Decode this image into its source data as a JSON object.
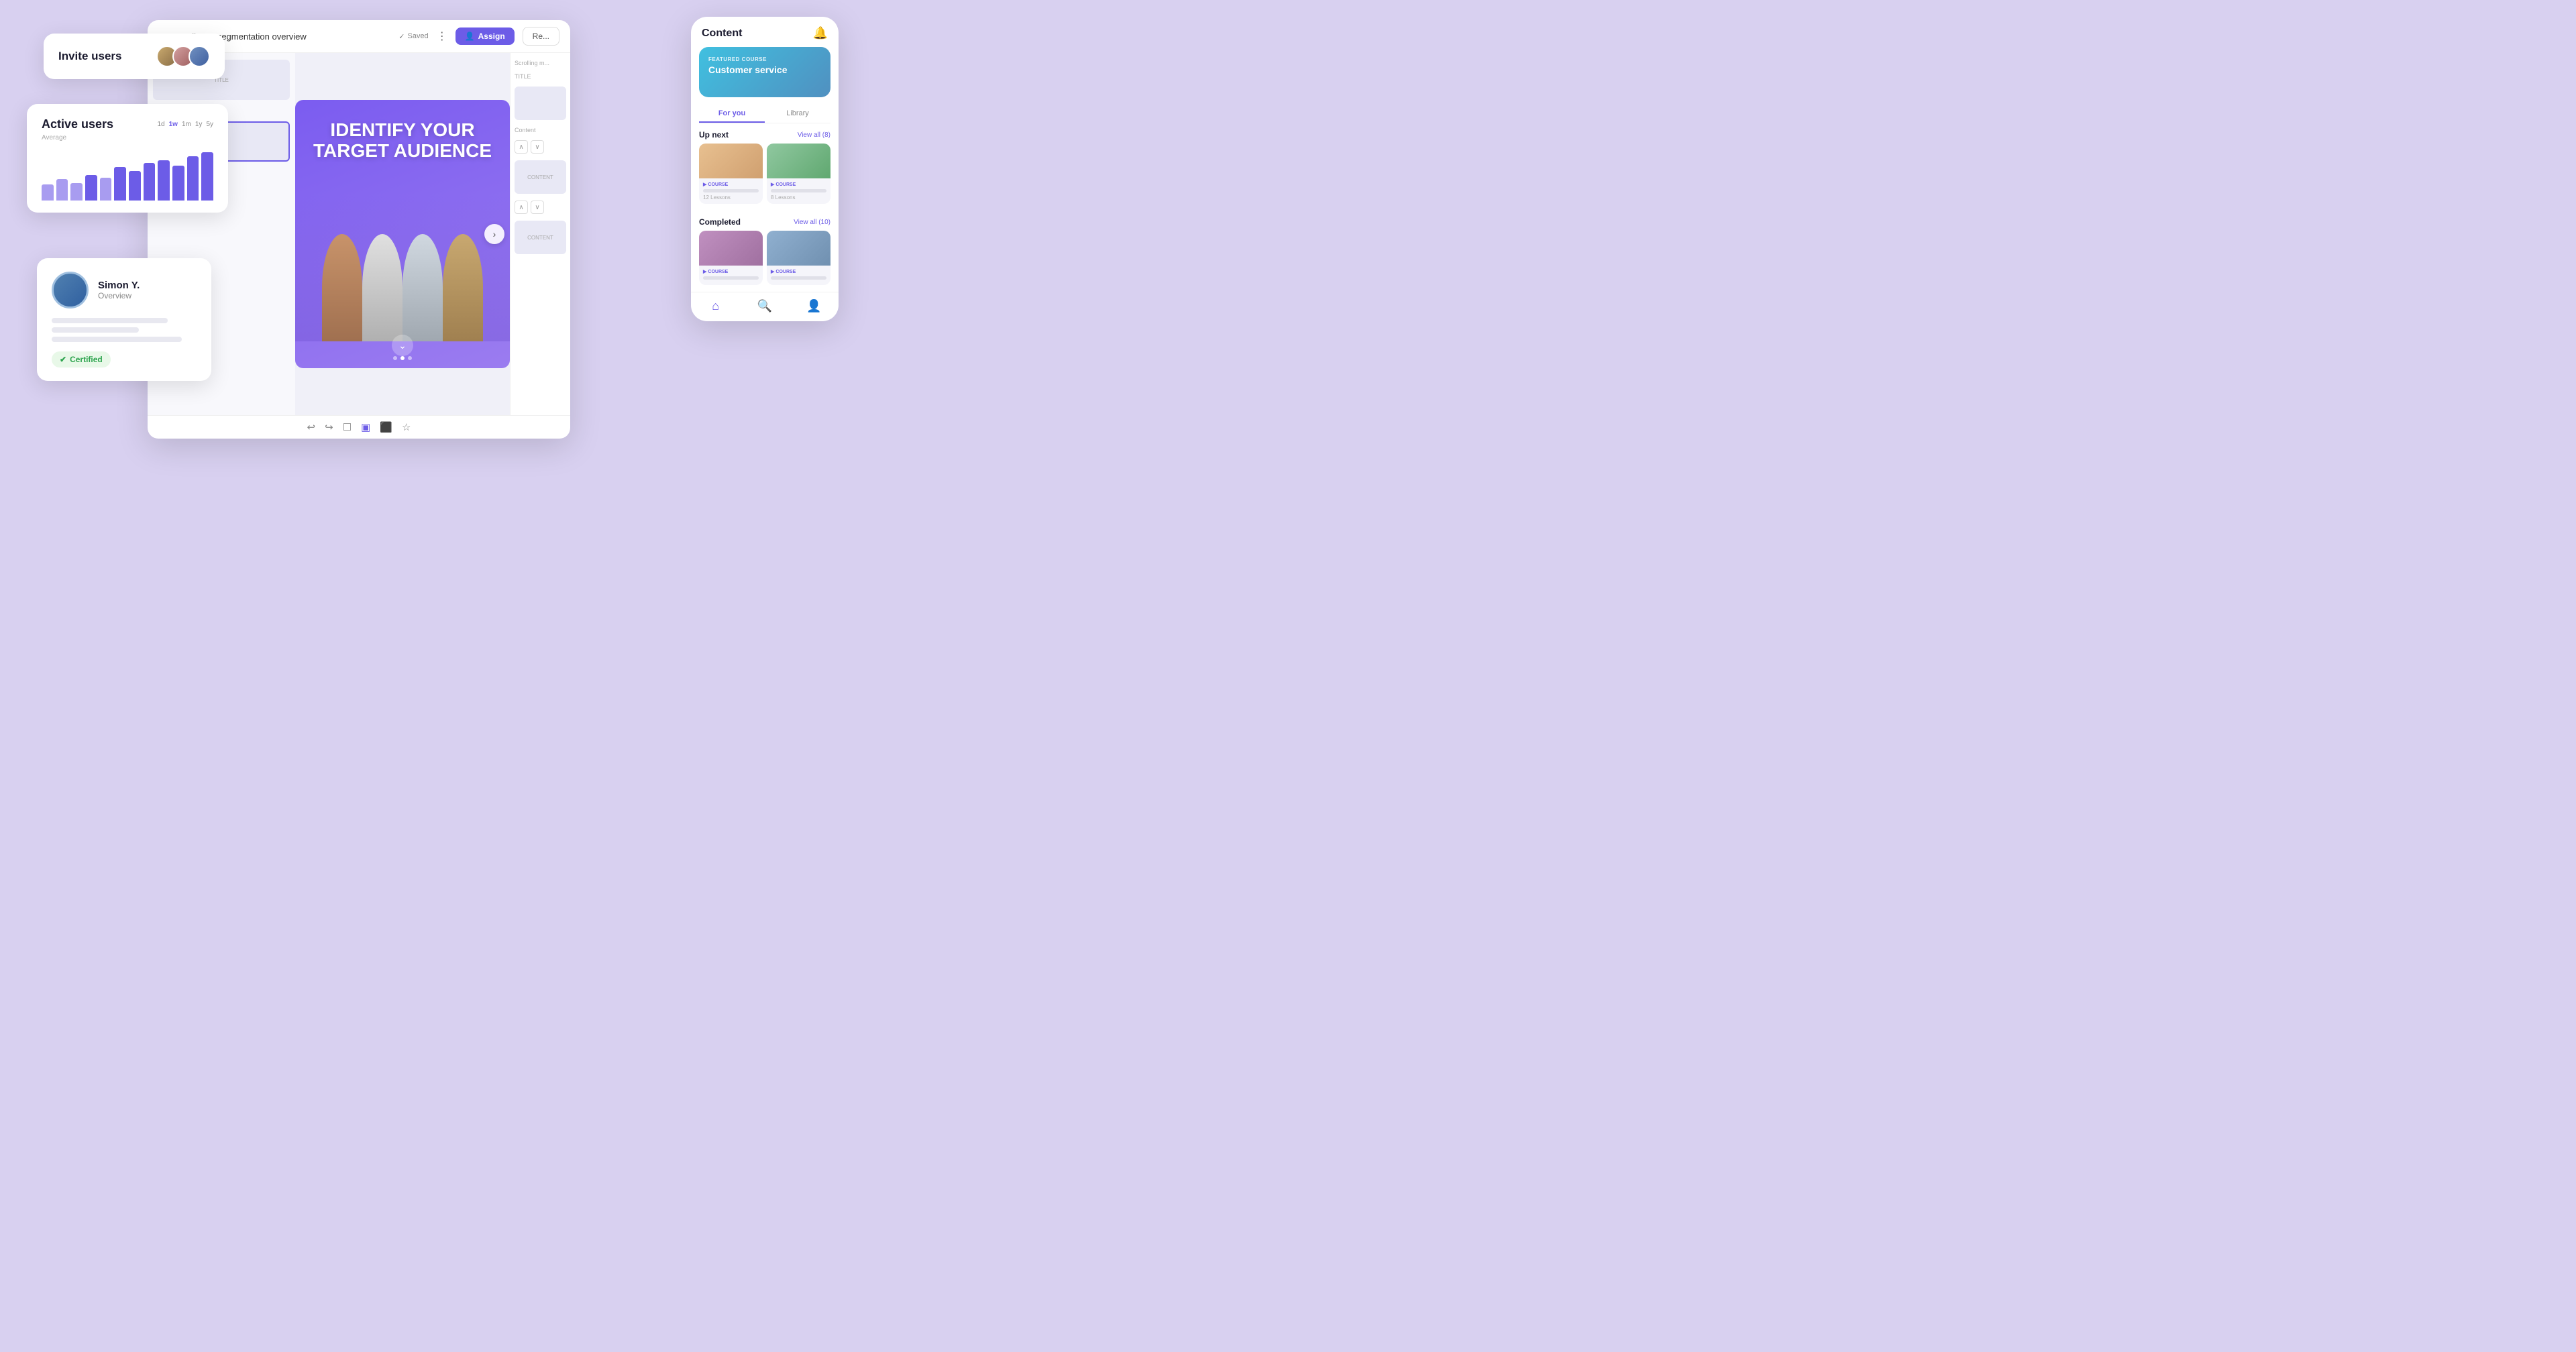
{
  "background": "#d8d0f0",
  "invite_card": {
    "title": "Invite users"
  },
  "active_users": {
    "title": "Active users",
    "average_label": "Average",
    "time_filters": [
      "1d",
      "1w",
      "1m",
      "1y",
      "5y"
    ],
    "active_filter": "1w",
    "bars": [
      30,
      42,
      35,
      50,
      45,
      60,
      55,
      68,
      72,
      65,
      80,
      85
    ]
  },
  "profile": {
    "name": "Simon Y.",
    "role": "Overview",
    "certified_label": "Certified"
  },
  "editor": {
    "back_label": "←",
    "title": "Audience segmentation overview",
    "saved_label": "Saved",
    "assign_label": "Assign",
    "review_label": "Re...",
    "slide_headline_line1": "IDENTIFY YOUR",
    "slide_headline_line2": "TARGET AUDIENCE",
    "title_label": "TITLE",
    "content_label": "Content",
    "content_label2": "CONTENT",
    "scrolling_label": "Scrolling m...",
    "toolbar_icons": [
      "↩",
      "↪",
      "☐",
      "▣",
      "⬛",
      "☆"
    ]
  },
  "mobile": {
    "title": "Content",
    "featured_label": "FEATURED COURSE",
    "featured_course": "Customer service",
    "tabs": [
      "For you",
      "Library"
    ],
    "active_tab": "For you",
    "up_next_label": "Up next",
    "view_all_up_next": "View all (8)",
    "completed_label": "Completed",
    "view_all_completed": "View all (10)",
    "courses": [
      {
        "type": "COURSE",
        "lessons": "12 Lessons",
        "thumb": "ct1"
      },
      {
        "type": "COURSE",
        "lessons": "8 Lessons",
        "thumb": "ct2"
      }
    ],
    "completed_courses": [
      {
        "type": "COURSE",
        "thumb": "ct3"
      },
      {
        "type": "COURSE",
        "thumb": "ct4"
      }
    ]
  }
}
